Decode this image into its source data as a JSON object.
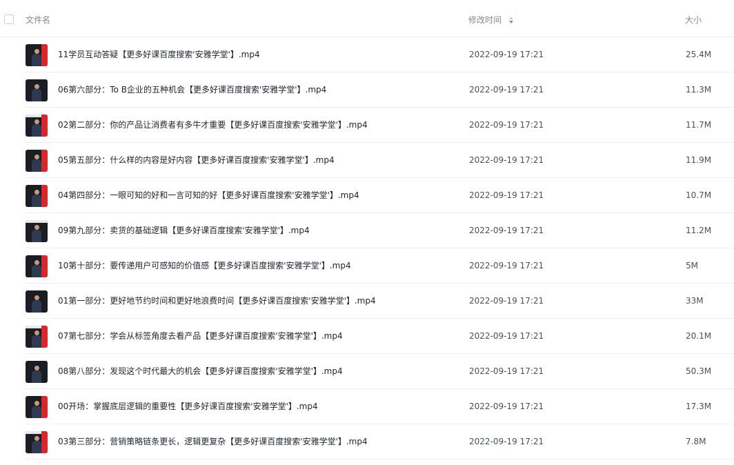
{
  "header": {
    "name_label": "文件名",
    "time_label": "修改时间",
    "size_label": "大小",
    "sort_icon": "sort-icon"
  },
  "files": [
    {
      "name": "11学员互动答疑【更多好课百度搜索'安雅学堂'】.mp4",
      "time": "2022-09-19 17:21",
      "size": "25.4M"
    },
    {
      "name": "06第六部分：To B企业的五种机会【更多好课百度搜索'安雅学堂'】.mp4",
      "time": "2022-09-19 17:21",
      "size": "11.3M"
    },
    {
      "name": "02第二部分：你的产品让消费者有多牛才重要【更多好课百度搜索'安雅学堂'】.mp4",
      "time": "2022-09-19 17:21",
      "size": "11.7M"
    },
    {
      "name": "05第五部分：什么样的内容是好内容【更多好课百度搜索'安雅学堂'】.mp4",
      "time": "2022-09-19 17:21",
      "size": "11.9M"
    },
    {
      "name": "04第四部分：一眼可知的好和一言可知的好【更多好课百度搜索'安雅学堂'】.mp4",
      "time": "2022-09-19 17:21",
      "size": "10.7M"
    },
    {
      "name": "09第九部分：卖货的基础逻辑【更多好课百度搜索'安雅学堂'】.mp4",
      "time": "2022-09-19 17:21",
      "size": "11.2M"
    },
    {
      "name": "10第十部分：要传递用户可感知的价值感【更多好课百度搜索'安雅学堂'】.mp4",
      "time": "2022-09-19 17:21",
      "size": "5M"
    },
    {
      "name": "01第一部分：更好地节约时间和更好地浪费时间【更多好课百度搜索'安雅学堂'】.mp4",
      "time": "2022-09-19 17:21",
      "size": "33M"
    },
    {
      "name": "07第七部分：学会从标签角度去看产品【更多好课百度搜索'安雅学堂'】.mp4",
      "time": "2022-09-19 17:21",
      "size": "20.1M"
    },
    {
      "name": "08第八部分：发现这个时代最大的机会【更多好课百度搜索'安雅学堂'】.mp4",
      "time": "2022-09-19 17:21",
      "size": "50.3M"
    },
    {
      "name": "00开场：掌握底层逻辑的重要性【更多好课百度搜索'安雅学堂'】.mp4",
      "time": "2022-09-19 17:21",
      "size": "17.3M"
    },
    {
      "name": "03第三部分：营销策略链条更长，逻辑更复杂【更多好课百度搜索'安雅学堂'】.mp4",
      "time": "2022-09-19 17:21",
      "size": "7.8M"
    }
  ],
  "colors": {
    "sort_accent": "#3aa0ff",
    "thumb_red": "#d8262d"
  }
}
